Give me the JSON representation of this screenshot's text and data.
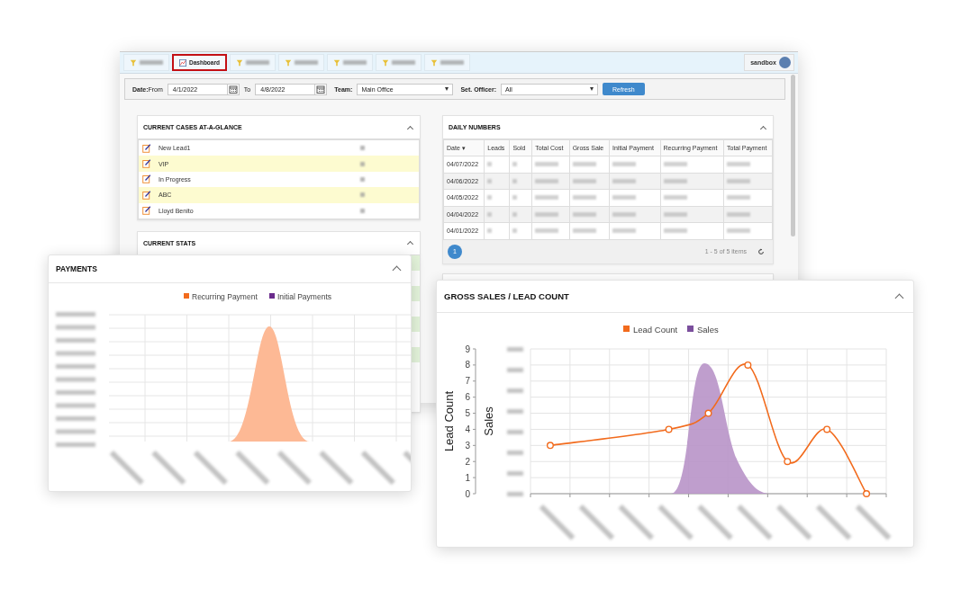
{
  "tabs": [
    {
      "selected": false
    },
    {
      "label": "Dashboard",
      "selected": true
    },
    {
      "selected": false
    },
    {
      "selected": false
    },
    {
      "selected": false
    },
    {
      "selected": false
    },
    {
      "selected": false
    }
  ],
  "user": {
    "name": "sandbox"
  },
  "filters": {
    "date_label": "**Date:**From",
    "from": "4/1/2022",
    "to_label": "To",
    "to": "4/8/2022",
    "team_label": "Team:",
    "team": "Main Office",
    "officer_label": "Set. Officer:",
    "officer": "All",
    "refresh": "Refresh"
  },
  "cases": {
    "title": "CURRENT CASES AT-A-GLANCE",
    "items": [
      {
        "name": "New Lead1",
        "highlighted": false
      },
      {
        "name": "VIP",
        "highlighted": true
      },
      {
        "name": "In Progress",
        "highlighted": false
      },
      {
        "name": "ABC",
        "highlighted": true
      },
      {
        "name": "Lloyd Benito",
        "highlighted": false
      }
    ]
  },
  "stats": {
    "title": "CURRENT STATS"
  },
  "daily": {
    "title": "DAILY NUMBERS",
    "columns": [
      "Date ▾",
      "Leads",
      "Sold",
      "Total Cost",
      "Gross Sale",
      "Initial Payment",
      "Recurring Payment",
      "Total Payment"
    ],
    "rows": [
      "04/07/2022",
      "04/06/2022",
      "04/05/2022",
      "04/04/2022",
      "04/01/2022"
    ],
    "page": "1",
    "summary": "1 - 5 of 5 items"
  },
  "payments": {
    "title": "PAYMENTS",
    "legend": [
      {
        "name": "Recurring Payment",
        "color": "#f26b1d"
      },
      {
        "name": "Initial Payments",
        "color": "#6a2c8c"
      }
    ]
  },
  "gross": {
    "title": "GROSS SALES / LEAD COUNT",
    "secondary": {
      "name": "Sales",
      "color": "#7b4f9d",
      "axis_label": "Sales"
    },
    "lead": {
      "name": "Lead Count",
      "color": "#f26b1d",
      "axis_label": "Lead Count",
      "ticks": [
        "9",
        "8",
        "7",
        "6",
        "5",
        "4",
        "3",
        "2",
        "1",
        "0"
      ]
    }
  }
}
